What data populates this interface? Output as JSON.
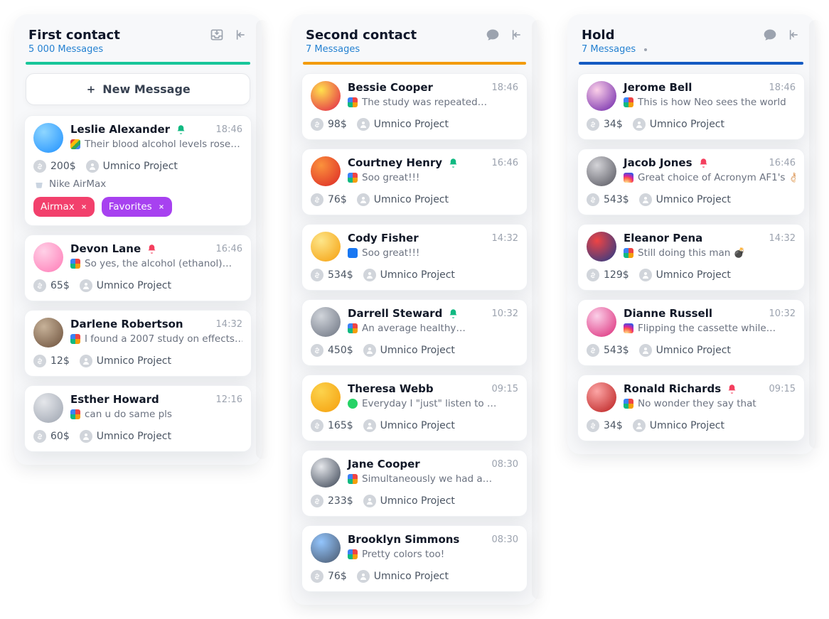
{
  "columns": [
    {
      "title": "First contact",
      "subtitle": "5 000 Messages",
      "barColor": "#18c69a",
      "headerIcons": [
        "inbox",
        "collapse"
      ],
      "hasDot": false,
      "showNewMessage": true,
      "newMessageLabel": "New Message",
      "cards": [
        {
          "name": "Leslie Alexander",
          "time": "18:46",
          "bell": "green",
          "source": "google",
          "snippet": "Their blood alcohol levels rose…",
          "price": "200$",
          "project": "Umnico Project",
          "avatarGrad": [
            "#8ed6ff",
            "#1e90ff"
          ],
          "extraLine": {
            "icon": "basket",
            "text": "Nike AirMax"
          },
          "tags": [
            {
              "label": "Airmax",
              "color": "#f2406c"
            },
            {
              "label": "Favorites",
              "color": "#a741f0"
            }
          ]
        },
        {
          "name": "Devon Lane",
          "time": "16:46",
          "bell": "red",
          "source": "multi",
          "snippet": "So yes, the alcohol (ethanol)…",
          "price": "65$",
          "project": "Umnico Project",
          "avatarGrad": [
            "#ffd1e7",
            "#ff7ab6"
          ]
        },
        {
          "name": "Darlene Robertson",
          "time": "14:32",
          "bell": null,
          "source": "multi",
          "snippet": "I found a 2007 study on effects…",
          "price": "12$",
          "project": "Umnico Project",
          "avatarGrad": [
            "#c7b299",
            "#6b4f3a"
          ]
        },
        {
          "name": "Esther Howard",
          "time": "12:16",
          "bell": null,
          "source": "multi",
          "snippet": "can u do same pls",
          "price": "60$",
          "project": "Umnico Project",
          "avatarGrad": [
            "#e5e7eb",
            "#9ca3af"
          ]
        }
      ]
    },
    {
      "title": "Second contact",
      "subtitle": "7 Messages",
      "barColor": "#f39c0d",
      "headerIcons": [
        "comment",
        "collapse"
      ],
      "hasDot": false,
      "showNewMessage": false,
      "cards": [
        {
          "name": "Bessie Cooper",
          "time": "18:46",
          "bell": null,
          "source": "multi",
          "snippet": "The study was repeated…",
          "price": "98$",
          "project": "Umnico Project",
          "avatarGrad": [
            "#ffe14d",
            "#e11d48"
          ]
        },
        {
          "name": "Courtney Henry",
          "time": "16:46",
          "bell": "green",
          "source": "multi",
          "snippet": "Soo great!!!",
          "price": "76$",
          "project": "Umnico Project",
          "avatarGrad": [
            "#fb923c",
            "#dc2626"
          ]
        },
        {
          "name": "Cody Fisher",
          "time": "14:32",
          "bell": null,
          "source": "fb",
          "snippet": "Soo great!!!",
          "price": "534$",
          "project": "Umnico Project",
          "avatarGrad": [
            "#fde68a",
            "#f59e0b"
          ]
        },
        {
          "name": "Darrell Steward",
          "time": "10:32",
          "bell": "green",
          "source": "multi",
          "snippet": "An average healthy…",
          "price": "450$",
          "project": "Umnico Project",
          "avatarGrad": [
            "#d1d5db",
            "#6b7280"
          ]
        },
        {
          "name": "Theresa Webb",
          "time": "09:15",
          "bell": null,
          "source": "wa",
          "snippet": "Everyday I \"just\" listen to …",
          "price": "165$",
          "project": "Umnico Project",
          "avatarGrad": [
            "#fcd34d",
            "#f59e0b"
          ]
        },
        {
          "name": "Jane Cooper",
          "time": "08:30",
          "bell": null,
          "source": "multi",
          "snippet": "Simultaneously we had a…",
          "price": "233$",
          "project": "Umnico Project",
          "avatarGrad": [
            "#e5e7eb",
            "#374151"
          ]
        },
        {
          "name": "Brooklyn Simmons",
          "time": "08:30",
          "bell": null,
          "source": "multi",
          "snippet": "Pretty colors too!",
          "price": "76$",
          "project": "Umnico Project",
          "avatarGrad": [
            "#93c5fd",
            "#475569"
          ]
        }
      ]
    },
    {
      "title": "Hold",
      "subtitle": "7 Messages",
      "barColor": "#155bc2",
      "headerIcons": [
        "comment",
        "collapse"
      ],
      "hasDot": true,
      "showNewMessage": false,
      "cards": [
        {
          "name": "Jerome Bell",
          "time": "18:46",
          "bell": null,
          "source": "multi",
          "snippet": "This is how Neo sees the world",
          "price": "34$",
          "project": "Umnico Project",
          "avatarGrad": [
            "#fbcfe8",
            "#6b21a8"
          ]
        },
        {
          "name": "Jacob Jones",
          "time": "16:46",
          "bell": "red",
          "source": "insta",
          "snippet": "Great choice of Acronym AF1's 👌🏻",
          "price": "543$",
          "project": "Umnico Project",
          "avatarGrad": [
            "#d4d4d8",
            "#52525b"
          ]
        },
        {
          "name": "Eleanor Pena",
          "time": "14:32",
          "bell": null,
          "source": "multi",
          "snippet": "Still doing this man 💣",
          "price": "129$",
          "project": "Umnico Project",
          "avatarGrad": [
            "#ef4444",
            "#1e3a8a"
          ]
        },
        {
          "name": "Dianne Russell",
          "time": "10:32",
          "bell": null,
          "source": "insta",
          "snippet": "Flipping the cassette while…",
          "price": "543$",
          "project": "Umnico Project",
          "avatarGrad": [
            "#fbcfe8",
            "#db2777"
          ]
        },
        {
          "name": "Ronald Richards",
          "time": "09:15",
          "bell": "red",
          "source": "multi",
          "snippet": "No wonder they say that",
          "price": "34$",
          "project": "Umnico Project",
          "avatarGrad": [
            "#fca5a5",
            "#b91c1c"
          ]
        }
      ]
    }
  ]
}
